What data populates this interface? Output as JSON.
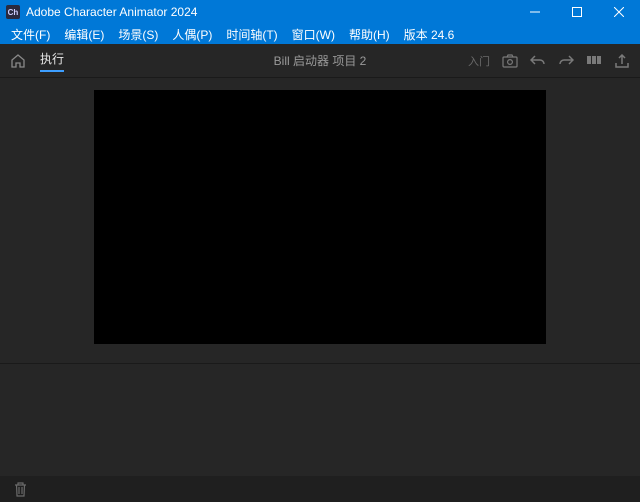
{
  "titlebar": {
    "app_title": "Adobe Character Animator 2024",
    "app_icon_text": "Ch"
  },
  "menus": {
    "file": "文件(F)",
    "edit": "编辑(E)",
    "scene": "场景(S)",
    "puppet": "人偶(P)",
    "timeline": "时间轴(T)",
    "window": "窗口(W)",
    "help": "帮助(H)",
    "version": "版本 24.6"
  },
  "toolbar": {
    "tab_label": "执行",
    "scene_title": "Bill 启动器 项目 2",
    "mode_label": "入门"
  }
}
